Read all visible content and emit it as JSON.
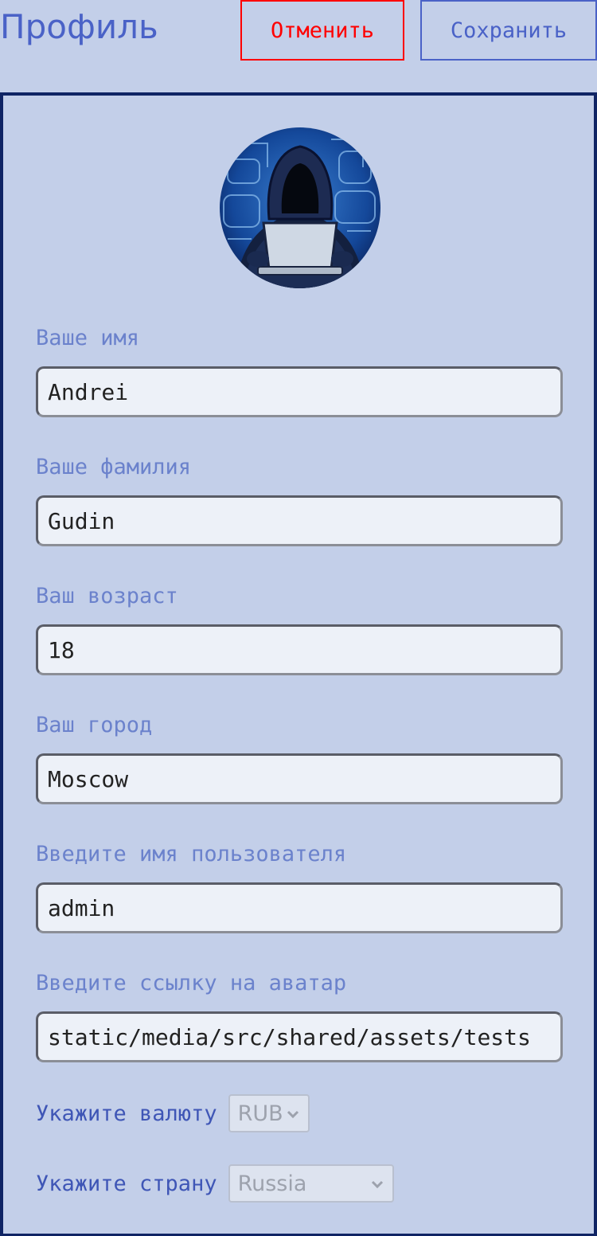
{
  "header": {
    "title": "Профиль",
    "cancel_label": "Отменить",
    "save_label": "Сохранить"
  },
  "profile": {
    "avatar_icon": "hooded-hacker-avatar",
    "fields": [
      {
        "label": "Ваше имя",
        "value": "Andrei"
      },
      {
        "label": "Ваше фамилия",
        "value": "Gudin"
      },
      {
        "label": "Ваш возраст",
        "value": "18"
      },
      {
        "label": "Ваш город",
        "value": "Moscow"
      },
      {
        "label": "Введите имя пользователя",
        "value": "admin"
      },
      {
        "label": "Введите ссылку на аватар",
        "value": "static/media/src/shared/assets/tests"
      }
    ],
    "currency": {
      "label": "Укажите валюту",
      "selected": "RUB"
    },
    "country": {
      "label": "Укажите страну",
      "selected": "Russia"
    }
  },
  "colors": {
    "background": "#c3cfe9",
    "accent": "#4a62c7",
    "danger": "#ff0000",
    "card_border": "#0f2464"
  }
}
